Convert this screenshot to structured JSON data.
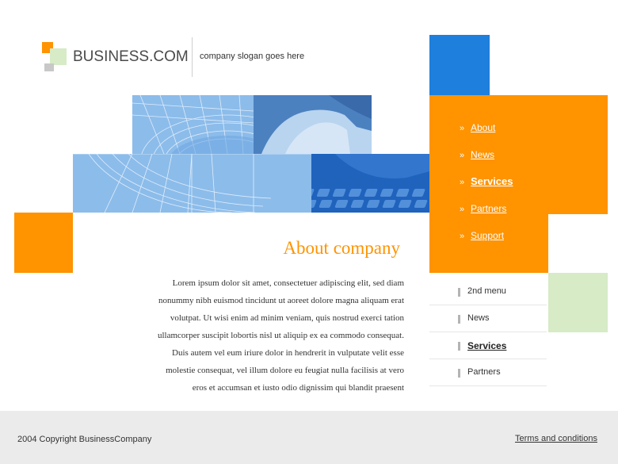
{
  "header": {
    "logo_text": "BUSINESS.COM",
    "slogan": "company slogan goes here"
  },
  "nav": {
    "items": [
      {
        "label": "About"
      },
      {
        "label": "News"
      },
      {
        "label": "Services"
      },
      {
        "label": "Partners"
      },
      {
        "label": "Support"
      }
    ],
    "active": "Services"
  },
  "main": {
    "heading": "About company",
    "body_lines": [
      "Lorem ipsum dolor sit amet, consectetuer adipiscing elit, sed diam",
      "nonummy nibh euismod tincidunt ut aoreet dolore magna aliquam erat",
      "volutpat. Ut wisi enim ad minim veniam, quis nostrud exerci tation",
      "ullamcorper suscipit lobortis nisl ut aliquip ex ea commodo consequat.",
      "Duis autem vel eum iriure dolor in hendrerit in vulputate velit esse",
      "molestie consequat, vel illum dolore eu feugiat nulla facilisis at vero",
      "eros et accumsan et iusto odio dignissim qui blandit praesent"
    ]
  },
  "submenu": {
    "items": [
      {
        "label": "2nd menu"
      },
      {
        "label": "News"
      },
      {
        "label": "Services"
      },
      {
        "label": "Partners"
      }
    ],
    "active": "Services"
  },
  "footer": {
    "copyright": "2004 Copyright BusinessCompany",
    "terms": "Terms and conditions"
  },
  "colors": {
    "accent_orange": "#ff9300",
    "accent_blue": "#1e7fdc",
    "accent_green": "#d6ebc6",
    "footer_bg": "#ebebeb"
  }
}
